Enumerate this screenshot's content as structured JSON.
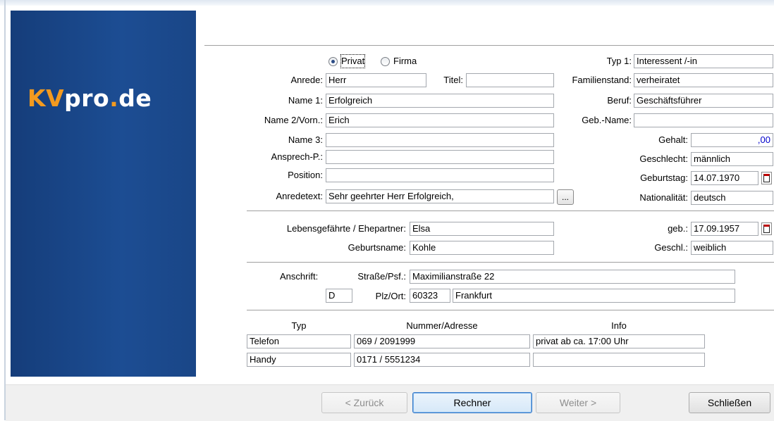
{
  "brand": {
    "logo_kv": "KV",
    "logo_mid": "pro",
    "logo_dot": ".",
    "logo_end": "de"
  },
  "person": {
    "type_options": {
      "privat": "Privat",
      "firma": "Firma",
      "selected": "privat"
    },
    "anrede": {
      "label": "Anrede:",
      "value": "Herr"
    },
    "titel": {
      "label": "Titel:",
      "value": ""
    },
    "name1": {
      "label": "Name 1:",
      "value": "Erfolgreich"
    },
    "name2": {
      "label": "Name 2/Vorn.:",
      "value": "Erich"
    },
    "name3": {
      "label": "Name 3:",
      "value": ""
    },
    "ansprech": {
      "label": "Ansprech-P.:",
      "value": ""
    },
    "position": {
      "label": "Position:",
      "value": ""
    },
    "anredetext": {
      "label": "Anredetext:",
      "value": "Sehr geehrter Herr Erfolgreich,",
      "dots": "..."
    },
    "typ1": {
      "label": "Typ 1:",
      "value": "Interessent /-in"
    },
    "familienstand": {
      "label": "Familienstand:",
      "value": "verheiratet"
    },
    "beruf": {
      "label": "Beruf:",
      "value": "Geschäftsführer"
    },
    "gebname": {
      "label": "Geb.-Name:",
      "value": ""
    },
    "gehalt": {
      "label": "Gehalt:",
      "value": ",00"
    },
    "geschlecht": {
      "label": "Geschlecht:",
      "value": "männlich"
    },
    "geburtstag": {
      "label": "Geburtstag:",
      "value": "14.07.1970"
    },
    "nationalitaet": {
      "label": "Nationalität:",
      "value": "deutsch"
    }
  },
  "partner": {
    "name": {
      "label": "Lebensgefährte / Ehepartner:",
      "value": "Elsa"
    },
    "geb": {
      "label": "geb.:",
      "value": "17.09.1957"
    },
    "geburtsname": {
      "label": "Geburtsname:",
      "value": "Kohle"
    },
    "geschl": {
      "label": "Geschl.:",
      "value": "weiblich"
    }
  },
  "address": {
    "label": "Anschrift:",
    "strasse": {
      "label": "Straße/Psf.:",
      "value": "Maximilianstraße 22"
    },
    "country": "D",
    "plzort_label": "Plz/Ort:",
    "plz": "60323",
    "ort": "Frankfurt"
  },
  "contacts": {
    "headers": [
      "Typ",
      "Nummer/Adresse",
      "Info"
    ],
    "rows": [
      {
        "typ": "Telefon",
        "nummer": "069 / 2091999",
        "info": "privat ab ca. 17:00 Uhr"
      },
      {
        "typ": "Handy",
        "nummer": "0171 / 5551234",
        "info": ""
      }
    ]
  },
  "footer": {
    "back": "< Zurück",
    "calc": "Rechner",
    "next": "Weiter >",
    "close": "Schließen"
  }
}
